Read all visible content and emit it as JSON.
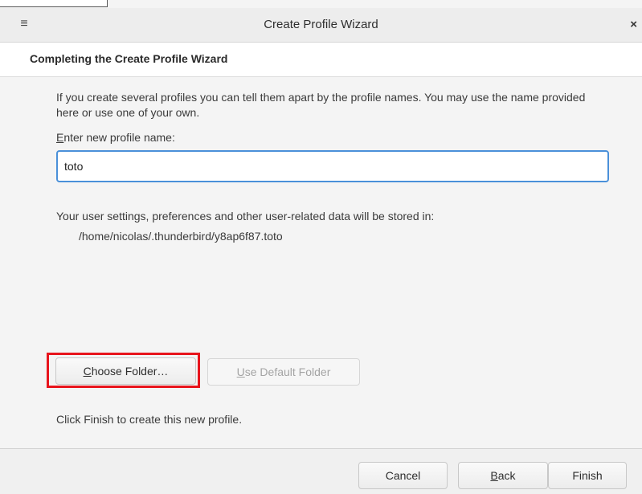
{
  "window": {
    "title": "Create Profile Wizard",
    "menu_icon": "≡",
    "close_icon": "×"
  },
  "header": {
    "title": "Completing the Create Profile Wizard"
  },
  "content": {
    "intro": "If you create several profiles you can tell them apart by the profile names. You may use the name provided here or use one of your own.",
    "name_label_mnemonic": "E",
    "name_label_rest": "nter new profile name:",
    "name_value": "toto",
    "storage_text": "Your user settings, preferences and other user-related data will be stored in:",
    "storage_path": "/home/nicolas/.thunderbird/y8ap6f87.toto",
    "choose_folder_mnemonic": "C",
    "choose_folder_rest": "hoose Folder…",
    "use_default_mnemonic": "U",
    "use_default_rest": "se Default Folder",
    "finish_note": "Click Finish to create this new profile."
  },
  "footer": {
    "cancel_label": "Cancel",
    "back_mnemonic": "B",
    "back_rest": "ack",
    "finish_label": "Finish"
  },
  "colors": {
    "input_focus": "#4a90d9",
    "highlight": "#e8141c"
  }
}
